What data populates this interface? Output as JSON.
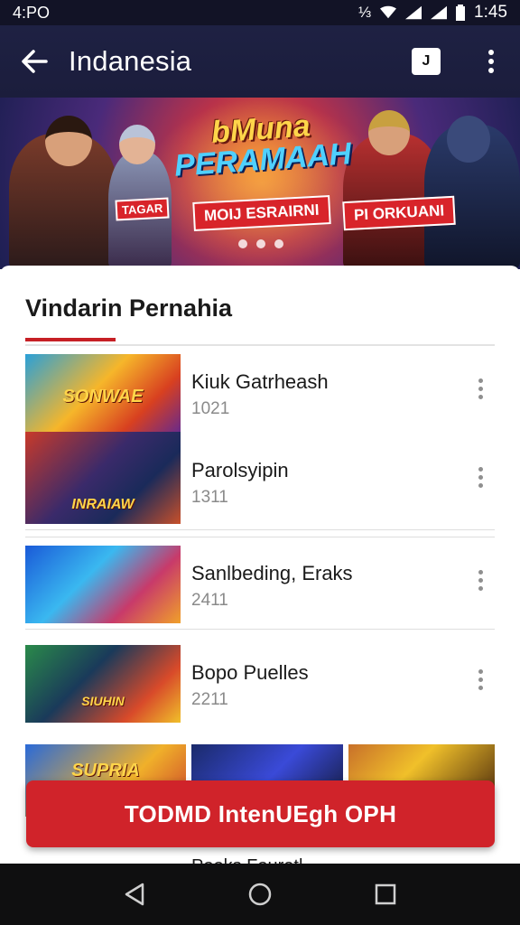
{
  "status": {
    "left_text": "4:PO",
    "right_icon_text": "⅓",
    "time": "1:45",
    "icons": [
      "signal-icon",
      "wifi-icon",
      "cell-icon",
      "battery-icon"
    ]
  },
  "app_bar": {
    "title": "Indanesia",
    "square_label": "J",
    "icons": [
      "back-arrow-icon",
      "bookmark-square-icon",
      "more-vert-icon"
    ]
  },
  "banner": {
    "headline_1": "bMuna",
    "headline_2": "PERAMAAH",
    "tag_left": "TAGAR",
    "tag_center": "MOIJ ESRAIRNI",
    "tag_right": "PI ORKUANI",
    "dots": 3,
    "colors": {
      "hot": "#f07a2a",
      "deep": "#1d1f52"
    }
  },
  "section": {
    "title": "Vindarin Pernahia"
  },
  "items": [
    {
      "title": "Kiuk Gatrheash",
      "sub": "1021",
      "thumb_label": "SONWAE"
    },
    {
      "title": "Parolsyipin",
      "sub": "1311",
      "thumb_label": "INRAIAW"
    },
    {
      "title": "Sanlbeding, Eraks",
      "sub": "2411",
      "thumb_label": ""
    },
    {
      "title": "Bopo Puelles",
      "sub": "2211",
      "thumb_label": "SIUHIN"
    }
  ],
  "bottom_strip": {
    "first_label": "SUPRIA",
    "partial_text": "Pooks Fouretl"
  },
  "cta": {
    "label": "TODMD IntenUEgh OPH"
  },
  "nav": {
    "icons": [
      "back-triangle-icon",
      "home-circle-icon",
      "recents-square-icon"
    ]
  },
  "colors": {
    "accent_red": "#d0232a",
    "app_bar": "#1e2143"
  }
}
